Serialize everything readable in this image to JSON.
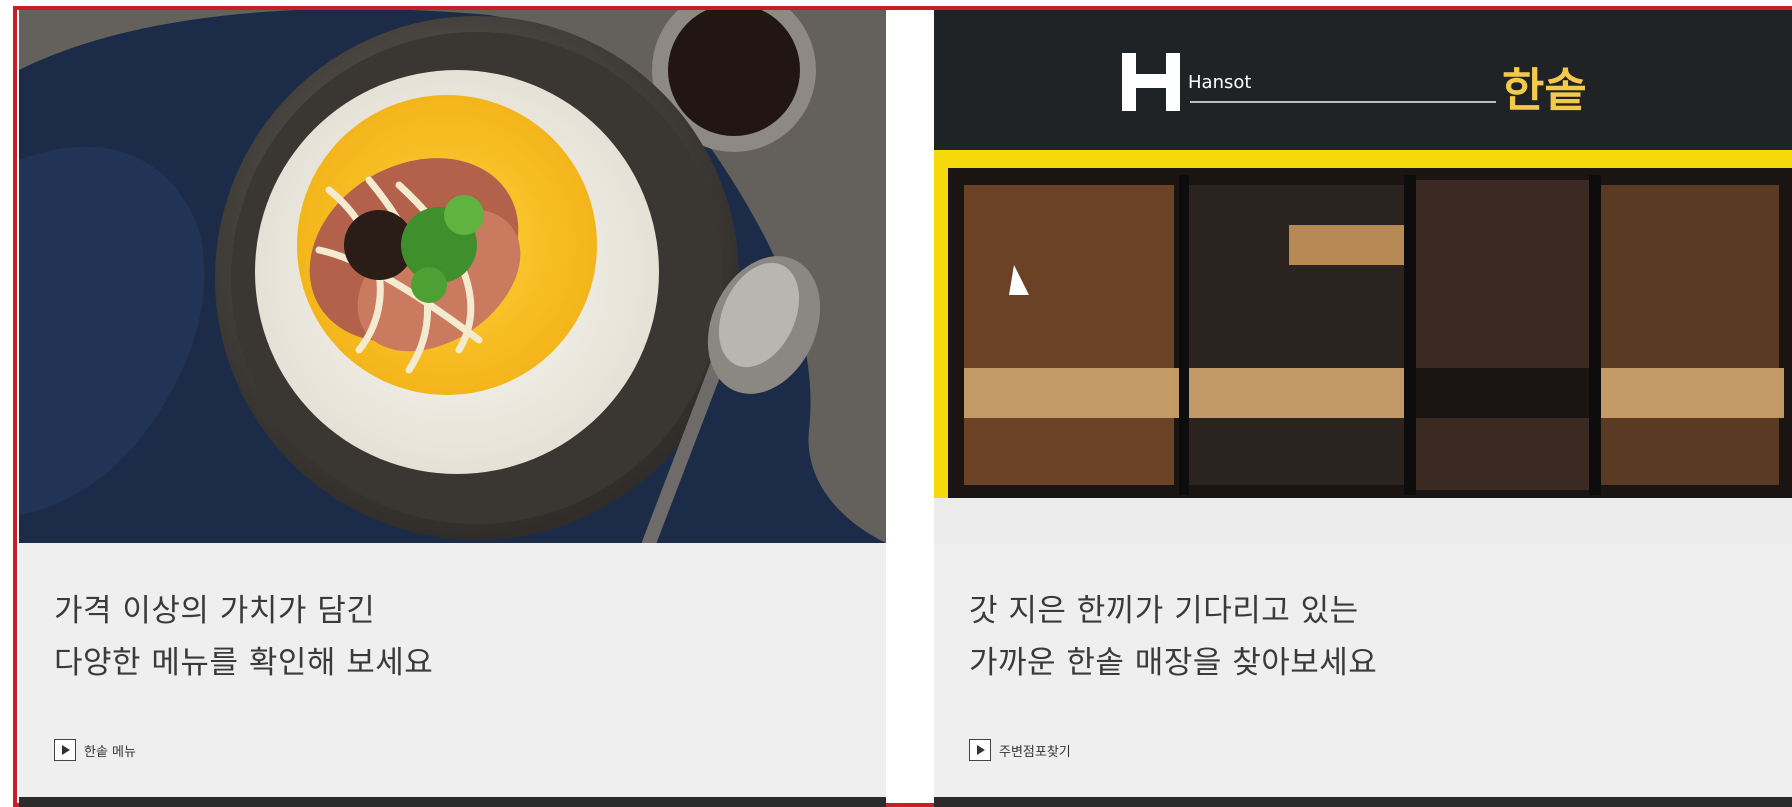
{
  "cards": [
    {
      "headline_line1": "가격 이상의 가치가 담긴",
      "headline_line2": "다양한 메뉴를 확인해 보세요",
      "link_label": "한솥 메뉴"
    },
    {
      "headline_line1": "갓 지은 한끼가 기다리고 있는",
      "headline_line2": "가까운 한솥 매장을 찾아보세요",
      "link_label": "주변점포찾기"
    }
  ],
  "store_sign": {
    "brand_en": "Hansot",
    "brand_ko": "한솥"
  },
  "icons": [
    "play-icon",
    "hansot-logo-icon"
  ],
  "colors": {
    "frame_border": "#c62027",
    "card_background": "#efeff0",
    "headline_text": "#3a3a3a",
    "sign_gold": "#f2c94c",
    "storefront_yellow": "#f5d90a"
  }
}
